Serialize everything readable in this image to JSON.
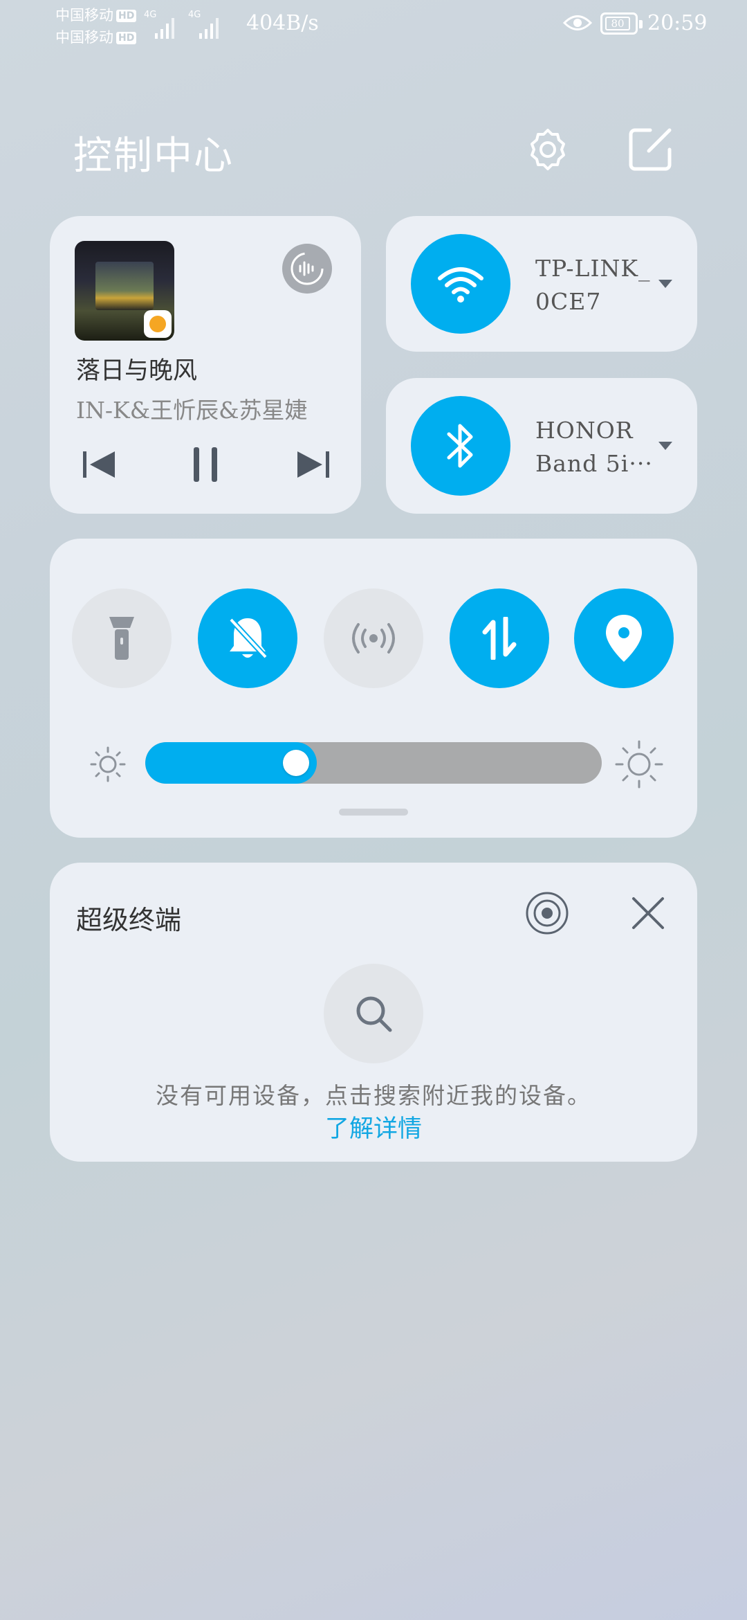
{
  "status_bar": {
    "carrier1": "中国移动",
    "carrier2": "中国移动",
    "hd": "HD",
    "net1": "4G",
    "net2": "4G",
    "speed": "404B/s",
    "battery": "80",
    "time": "20:59"
  },
  "header": {
    "title": "控制中心"
  },
  "media": {
    "song": "落日与晚风",
    "artist": "IN-K&王忻辰&苏星婕"
  },
  "wifi": {
    "line1": "TP-LINK_",
    "line2": "0CE7"
  },
  "bluetooth": {
    "line1": "HONOR",
    "line2": "Band 5i···"
  },
  "brightness": {
    "level": 0.33
  },
  "super_device": {
    "title": "超级终端",
    "hint": "没有可用设备，点击搜索附近我的设备。",
    "learn_more": "了解详情"
  },
  "colors": {
    "accent": "#00aeef",
    "card": "#ebeff5"
  }
}
